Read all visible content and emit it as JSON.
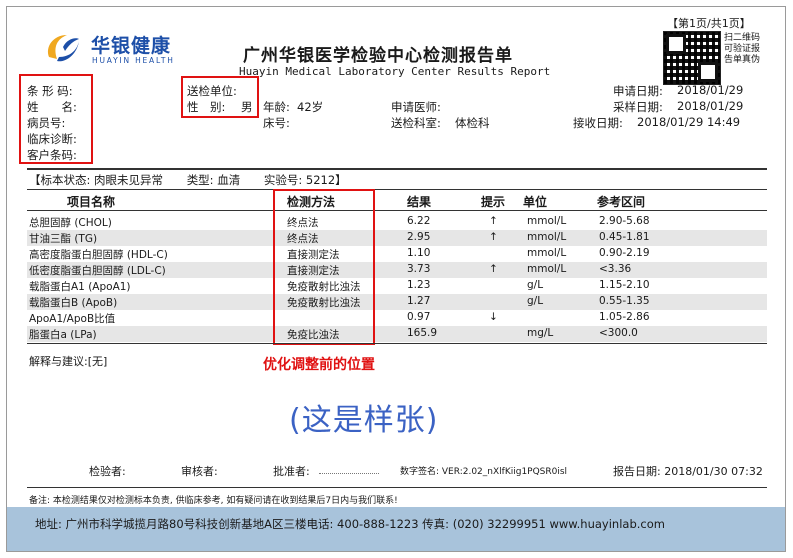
{
  "header": {
    "logo_cn": "华银健康",
    "logo_en": "HUAYIN HEALTH",
    "title_cn": "广州华银医学检验中心检测报告单",
    "title_en": "Huayin Medical Laboratory Center Results Report",
    "page_no": "【第1页/共1页】",
    "qr_note": "扫二维码可验证报告单真伪"
  },
  "patient": {
    "barcode_label": "条 形 码:",
    "name_label": "姓　　名:",
    "ward_label": "病员号:",
    "diagnosis_label": "临床诊断:",
    "customer_barcode_label": "客户条码:",
    "send_unit_label": "送检单位:",
    "gender_label": "性　别:",
    "gender_value": "男",
    "age_label": "年龄:",
    "age_value": "42岁",
    "bed_label": "床号:",
    "doctor_label": "申请医师:",
    "dept_label": "送检科室:",
    "dept_value": "体检科",
    "apply_date_label": "申请日期:",
    "apply_date_value": "2018/01/29",
    "sample_date_label": "采样日期:",
    "sample_date_value": "2018/01/29",
    "receive_date_label": "接收日期:",
    "receive_date_value": "2018/01/29 14:49"
  },
  "status": {
    "specimen_state": "【标本状态: 肉眼未见异常",
    "type": "类型: 血清",
    "exp_no": "实验号: 5212】"
  },
  "table": {
    "headers": {
      "name": "项目名称",
      "method": "检测方法",
      "result": "结果",
      "flag": "提示",
      "unit": "单位",
      "ref": "参考区间"
    },
    "rows": [
      {
        "name": "总胆固醇 (CHOL)",
        "method": "终点法",
        "result": "6.22",
        "flag": "↑",
        "unit": "mmol/L",
        "ref": "2.90-5.68"
      },
      {
        "name": "甘油三酯 (TG)",
        "method": "终点法",
        "result": "2.95",
        "flag": "↑",
        "unit": "mmol/L",
        "ref": "0.45-1.81"
      },
      {
        "name": "高密度脂蛋白胆固醇 (HDL-C)",
        "method": "直接测定法",
        "result": "1.10",
        "flag": "",
        "unit": "mmol/L",
        "ref": "0.90-2.19"
      },
      {
        "name": "低密度脂蛋白胆固醇 (LDL-C)",
        "method": "直接测定法",
        "result": "3.73",
        "flag": "↑",
        "unit": "mmol/L",
        "ref": "<3.36"
      },
      {
        "name": "载脂蛋白A1 (ApoA1)",
        "method": "免疫散射比浊法",
        "result": "1.23",
        "flag": "",
        "unit": "g/L",
        "ref": "1.15-2.10"
      },
      {
        "name": "载脂蛋白B (ApoB)",
        "method": "免疫散射比浊法",
        "result": "1.27",
        "flag": "",
        "unit": "g/L",
        "ref": "0.55-1.35"
      },
      {
        "name": "ApoA1/ApoB比值",
        "method": "",
        "result": "0.97",
        "flag": "↓",
        "unit": "",
        "ref": "1.05-2.86"
      },
      {
        "name": "脂蛋白a (LPa)",
        "method": "免疫比浊法",
        "result": "165.9",
        "flag": "",
        "unit": "mg/L",
        "ref": "<300.0"
      }
    ]
  },
  "advice": "解释与建议:[无]",
  "annotation_note": "优化调整前的位置",
  "sample_watermark": "(这是样张)",
  "signatures": {
    "tester": "检验者:",
    "reviewer": "审核者:",
    "approver": "批准者:",
    "digital_sig": "数字签名: VER:2.02_nXlfKiig1PQSR0isl",
    "report_date_label": "报告日期:",
    "report_date_value": "2018/01/30 07:32"
  },
  "disclaimer": "备注: 本检测结果仅对检测标本负责, 供临床参考, 如有疑问请在收到结果后7日内与我们联系!",
  "footer": {
    "text": "地址: 广州市科学城揽月路80号科技创新基地A区三楼电话: 400-888-1223 传真: (020) 32299951 www.huayinlab.com"
  },
  "colors": {
    "brand_blue": "#1d4fa8",
    "highlight_red": "#e01212",
    "footer_bg": "#a8c3db",
    "watermark_blue": "#3b62c4"
  }
}
